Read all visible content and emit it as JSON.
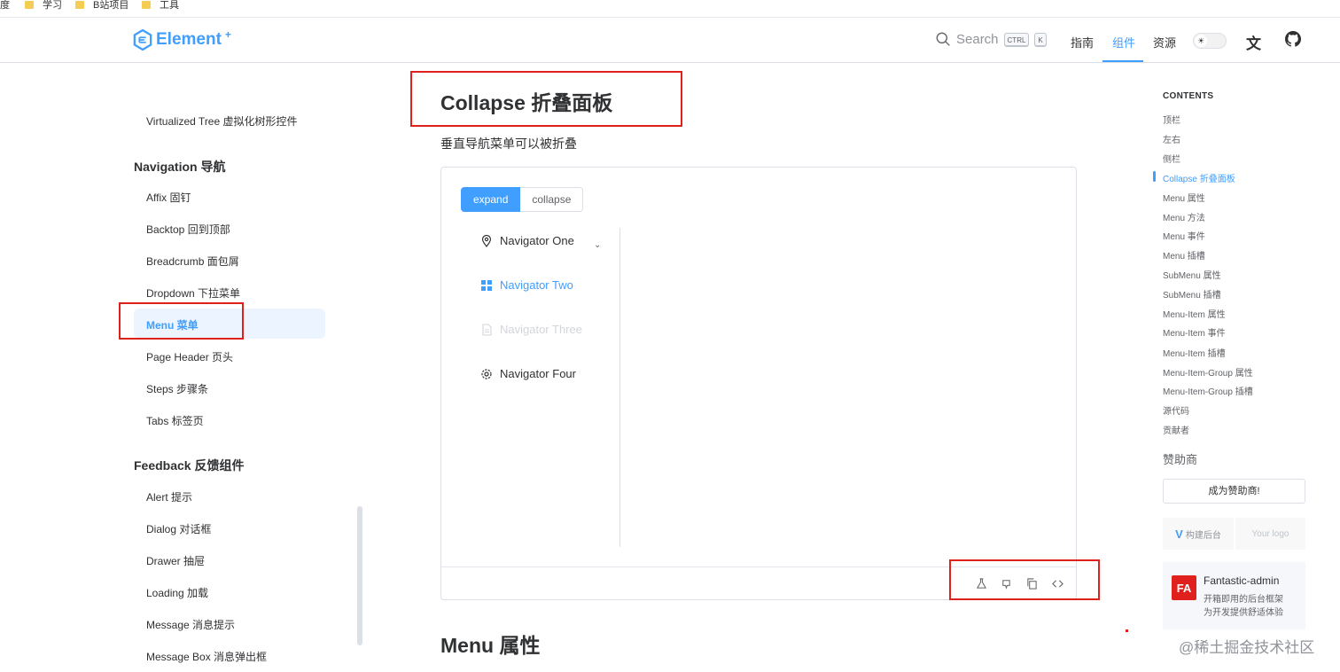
{
  "bookmarks": [
    "度",
    "学习",
    "B站项目",
    "工具"
  ],
  "header": {
    "logo_text": "Element",
    "logo_sup": "+",
    "search_label": "Search",
    "kbd1": "CTRL",
    "kbd2": "K",
    "nav": [
      "指南",
      "组件",
      "资源"
    ],
    "active_nav": "组件"
  },
  "sidebar": {
    "items_top": [
      "Virtualized Tree 虚拟化树形控件"
    ],
    "group_nav": "Navigation 导航",
    "nav_items": [
      "Affix 固钉",
      "Backtop 回到顶部",
      "Breadcrumb 面包屑",
      "Dropdown 下拉菜单",
      "Menu 菜单",
      "Page Header 页头",
      "Steps 步骤条",
      "Tabs 标签页"
    ],
    "active_item": "Menu 菜单",
    "group_feedback": "Feedback 反馈组件",
    "feedback_items": [
      "Alert 提示",
      "Dialog 对话框",
      "Drawer 抽屉",
      "Loading 加载",
      "Message 消息提示",
      "Message Box 消息弹出框"
    ]
  },
  "main": {
    "title": "Collapse 折叠面板",
    "description": "垂直导航菜单可以被折叠",
    "radio": {
      "expand": "expand",
      "collapse": "collapse",
      "selected": "expand"
    },
    "menu": [
      {
        "label": "Navigator One",
        "icon": "location-icon"
      },
      {
        "label": "Navigator Two",
        "icon": "grid-icon",
        "active": true
      },
      {
        "label": "Navigator Three",
        "icon": "document-icon",
        "disabled": true
      },
      {
        "label": "Navigator Four",
        "icon": "setting-icon"
      }
    ],
    "next_section": "Menu 属性"
  },
  "toc": {
    "heading": "CONTENTS",
    "items": [
      "顶栏",
      "左右",
      "侧栏",
      "Collapse 折叠面板",
      "Menu 属性",
      "Menu 方法",
      "Menu 事件",
      "Menu 插槽",
      "SubMenu 属性",
      "SubMenu 插槽",
      "Menu-Item 属性",
      "Menu-Item 事件",
      "Menu-Item 插槽",
      "Menu-Item-Group 属性",
      "Menu-Item-Group 插槽",
      "源代码",
      "贡献者"
    ],
    "active": "Collapse 折叠面板"
  },
  "sponsor": {
    "heading": "赞助商",
    "button": "成为赞助商!",
    "box1": "构建后台",
    "box2": "Your logo",
    "card_logo": "FA",
    "card_title": "Fantastic-admin",
    "card_line1": "开箱即用的后台框架",
    "card_line2": "为开发提供舒适体验"
  },
  "watermark": "@稀土掘金技术社区",
  "colors": {
    "accent": "#409eff",
    "annotation": "#e0201c"
  }
}
